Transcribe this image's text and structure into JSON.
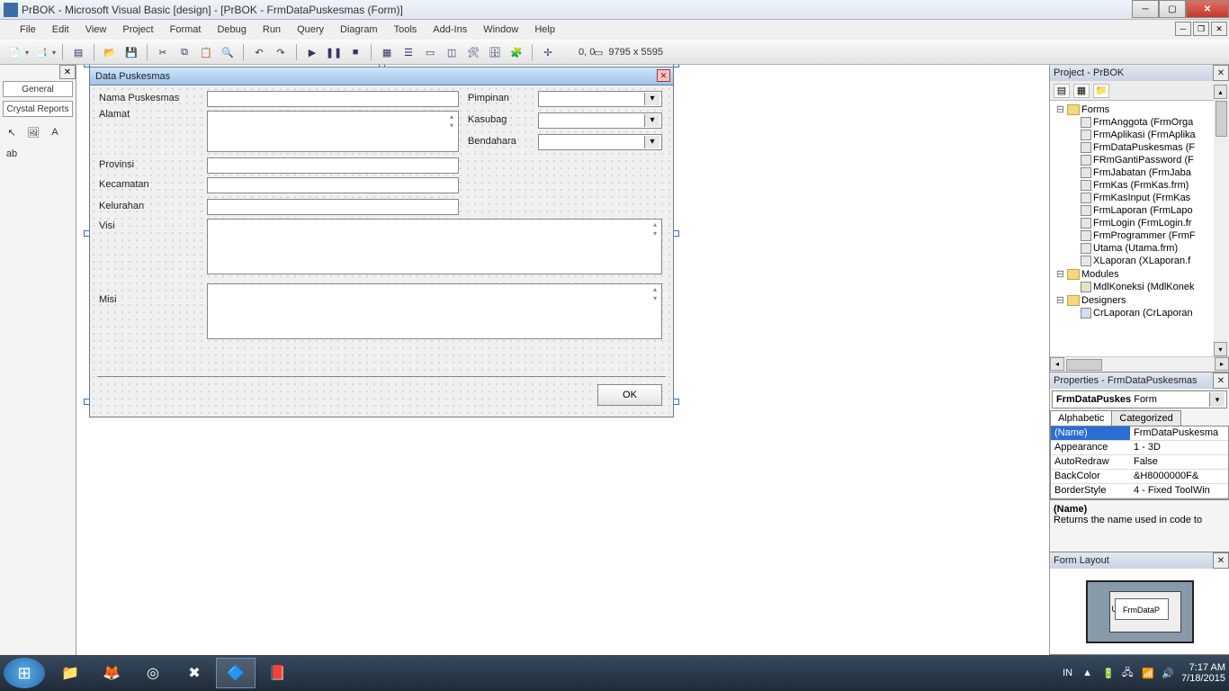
{
  "window": {
    "title": "PrBOK - Microsoft Visual Basic [design] - [PrBOK - FrmDataPuskesmas (Form)]"
  },
  "menu": {
    "items": [
      "File",
      "Edit",
      "View",
      "Project",
      "Format",
      "Debug",
      "Run",
      "Query",
      "Diagram",
      "Tools",
      "Add-Ins",
      "Window",
      "Help"
    ]
  },
  "toolbar": {
    "coords": "0, 0",
    "size": "9795 x 5595"
  },
  "toolbox": {
    "tabs": [
      "General",
      "Crystal Reports"
    ]
  },
  "form": {
    "caption": "Data Puskesmas",
    "labels": {
      "nama": "Nama Puskesmas",
      "alamat": "Alamat",
      "provinsi": "Provinsi",
      "kecamatan": "Kecamatan",
      "kelurahan": "Kelurahan",
      "visi": "Visi",
      "misi": "Misi",
      "pimpinan": "Pimpinan",
      "kasubag": "Kasubag",
      "bendahara": "Bendahara"
    },
    "ok": "OK"
  },
  "project": {
    "title": "Project - PrBOK",
    "folders": {
      "forms": "Forms",
      "modules": "Modules",
      "designers": "Designers"
    },
    "forms": [
      "FrmAnggota (FrmOrga",
      "FrmAplikasi (FrmAplika",
      "FrmDataPuskesmas (F",
      "FRmGantiPassword (F",
      "FrmJabatan (FrmJaba",
      "FrmKas (FrmKas.frm)",
      "FrmKasInput (FrmKas",
      "FrmLaporan (FrmLapo",
      "FrmLogin (FrmLogin.fr",
      "FrmProgrammer (FrmF",
      "Utama (Utama.frm)",
      "XLaporan (XLaporan.f"
    ],
    "modules": [
      "MdlKoneksi (MdlKonek"
    ],
    "designers": [
      "CrLaporan (CrLaporan"
    ]
  },
  "properties": {
    "title": "Properties - FrmDataPuskesmas",
    "object": "FrmDataPuskes",
    "object_type": "Form",
    "tabs": {
      "alpha": "Alphabetic",
      "cat": "Categorized"
    },
    "rows": [
      {
        "name": "(Name)",
        "value": "FrmDataPuskesma"
      },
      {
        "name": "Appearance",
        "value": "1 - 3D"
      },
      {
        "name": "AutoRedraw",
        "value": "False"
      },
      {
        "name": "BackColor",
        "value": "&H8000000F&"
      },
      {
        "name": "BorderStyle",
        "value": "4 - Fixed ToolWin"
      }
    ],
    "help_name": "(Name)",
    "help_text": "Returns the name used in code to"
  },
  "formlayout": {
    "title": "Form Layout",
    "formname": "FrmDataP",
    "u_label": "U"
  },
  "systray": {
    "lang": "IN",
    "time": "7:17 AM",
    "date": "7/18/2015"
  }
}
